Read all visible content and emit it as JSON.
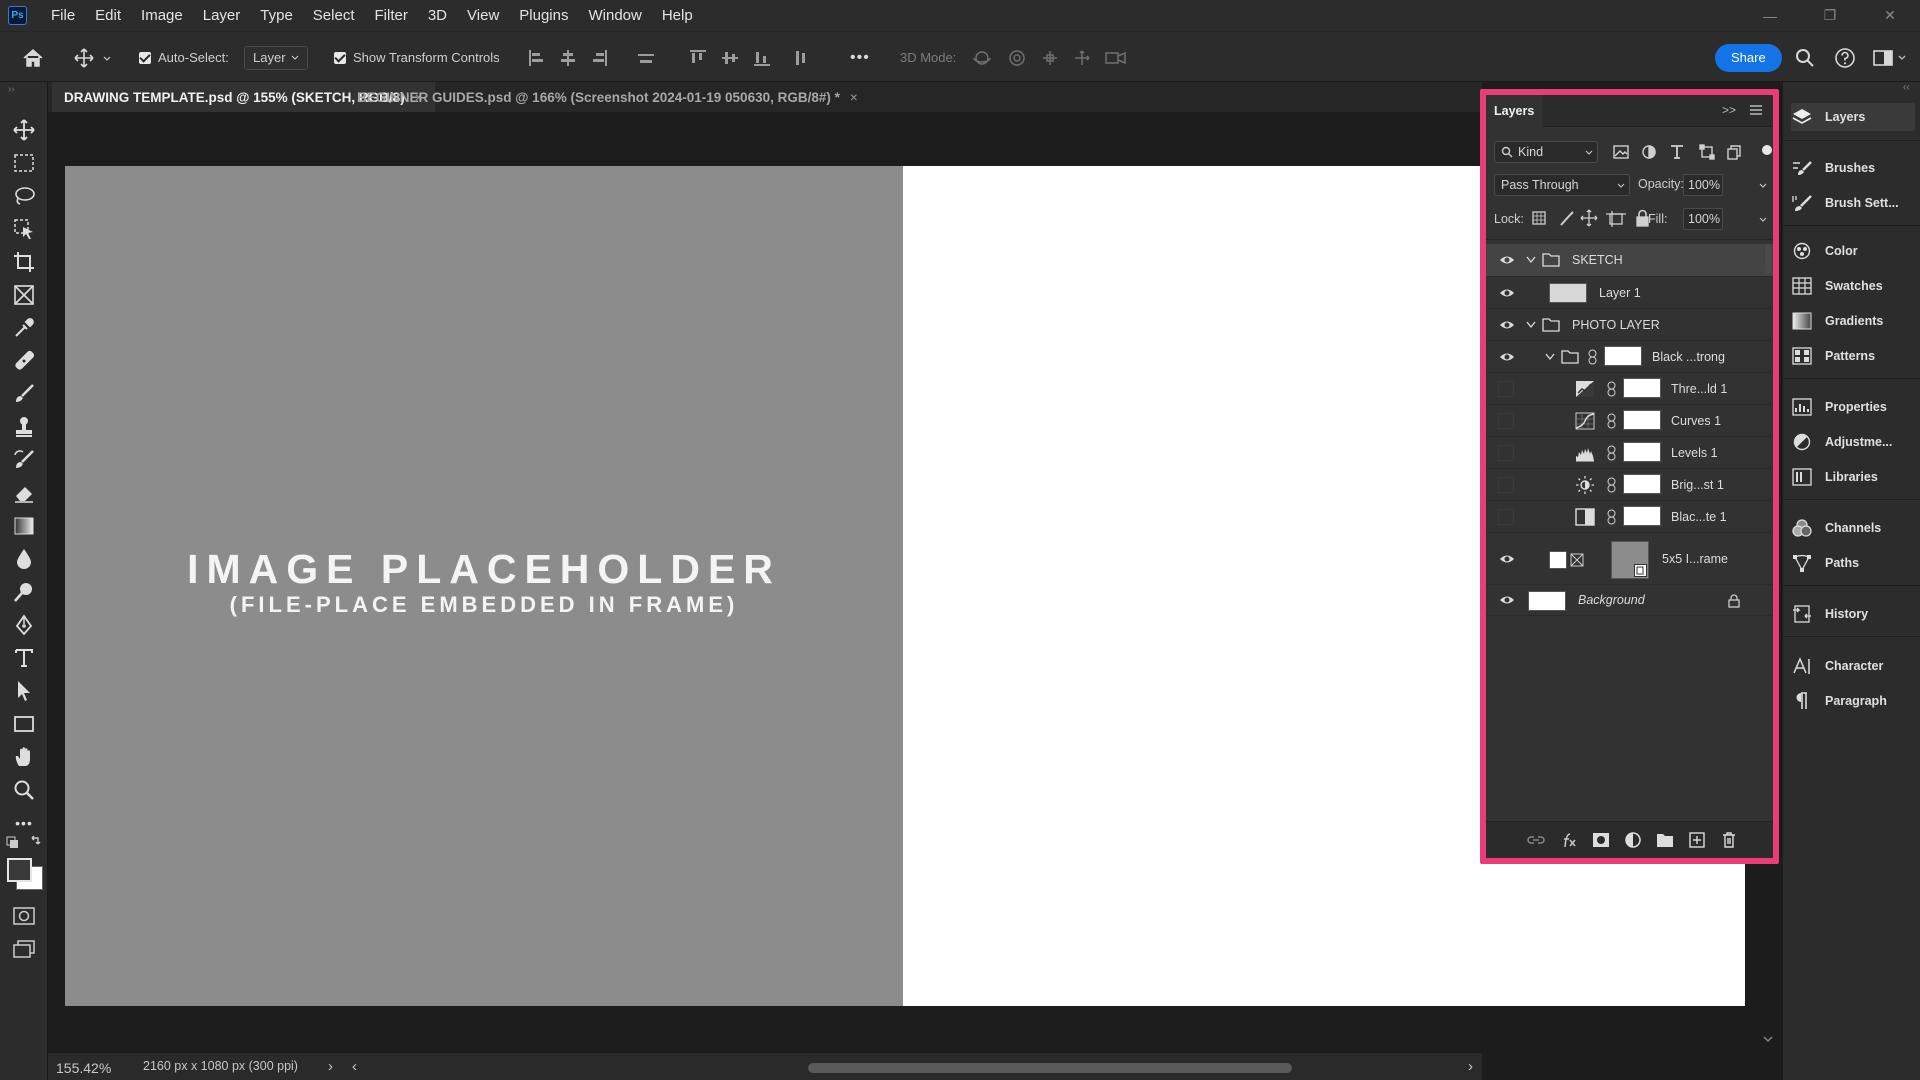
{
  "app": {
    "logo": "Ps"
  },
  "menu": [
    "File",
    "Edit",
    "Image",
    "Layer",
    "Type",
    "Select",
    "Filter",
    "3D",
    "View",
    "Plugins",
    "Window",
    "Help"
  ],
  "window_controls": [
    "—",
    "❐",
    "✕"
  ],
  "options": {
    "auto_select_label": "Auto-Select:",
    "auto_select_target": "Layer",
    "show_transform_label": "Show Transform Controls",
    "more": "•••",
    "mode_3d_label": "3D Mode:",
    "share_label": "Share"
  },
  "tabs": [
    {
      "label": "DRAWING TEMPLATE.psd @ 155% (SKETCH, RGB/8)",
      "close": "×"
    },
    {
      "label": "BEGINNER GUIDES.psd @ 166% (Screenshot 2024-01-19 050630, RGB/8#) *",
      "close": "×"
    }
  ],
  "canvas": {
    "placeholder_title": "IMAGE PLACEHOLDER",
    "placeholder_subtitle": "(FILE-PLACE EMBEDDED IN FRAME)"
  },
  "status": {
    "zoom": "155.42%",
    "doc_info": "2160 px x 1080 px (300 ppi)",
    "arrow": "›",
    "arrow_left": "‹"
  },
  "layers_panel": {
    "title": "Layers",
    "filter_kind": "Kind",
    "blend_mode": "Pass Through",
    "opacity_label": "Opacity:",
    "opacity_value": "100%",
    "lock_label": "Lock:",
    "fill_label": "Fill:",
    "fill_value": "100%",
    "layers": [
      {
        "name": "SKETCH",
        "type": "group",
        "visible": true,
        "selected": true
      },
      {
        "name": "Layer 1",
        "type": "pixel",
        "visible": true
      },
      {
        "name": "PHOTO LAYER",
        "type": "group",
        "visible": true
      },
      {
        "name": "Black ...trong",
        "type": "group-mask",
        "visible": true
      },
      {
        "name": "Thre...ld 1",
        "type": "threshold-icon",
        "visible": false
      },
      {
        "name": "Curves 1",
        "type": "curves-icon",
        "visible": false
      },
      {
        "name": "Levels 1",
        "type": "levels-icon",
        "visible": false
      },
      {
        "name": "Brig...st 1",
        "type": "brightness-icon",
        "visible": false
      },
      {
        "name": "Blac...te 1",
        "type": "black-white-icon",
        "visible": false
      },
      {
        "name": "5x5 I...rame",
        "type": "frame",
        "visible": true
      },
      {
        "name": "Background",
        "type": "background",
        "visible": true,
        "locked": true
      }
    ]
  },
  "dock": [
    "Layers",
    "Brushes",
    "Brush Sett...",
    "Color",
    "Swatches",
    "Gradients",
    "Patterns",
    "Properties",
    "Adjustme...",
    "Libraries",
    "Channels",
    "Paths",
    "History",
    "Character",
    "Paragraph"
  ],
  "colors": {
    "accent": "#1473e6",
    "highlight": "#ea3c78"
  }
}
